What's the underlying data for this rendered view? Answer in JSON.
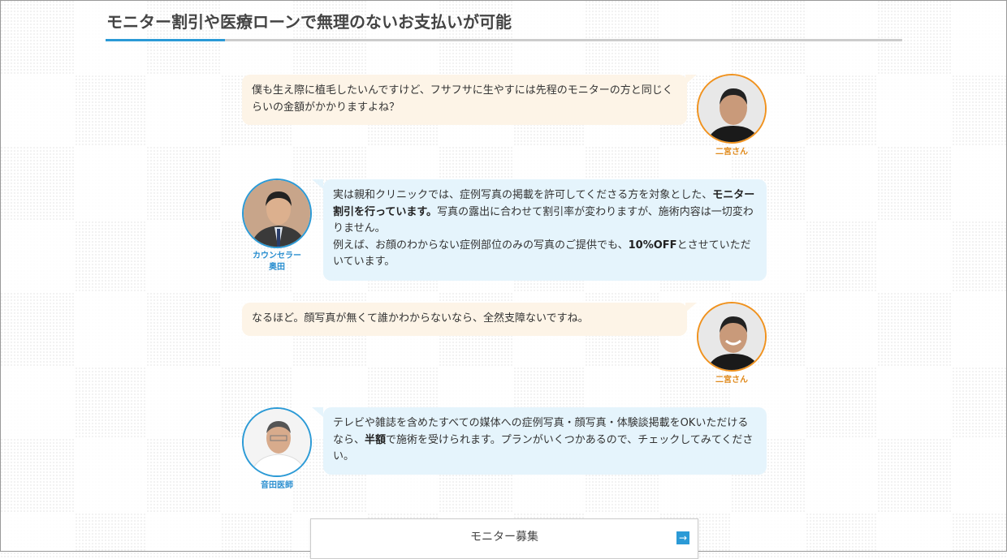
{
  "section_title": "モニター割引や医療ローンで無理のないお支払いが可能",
  "colors": {
    "accent": "#2b9ad6",
    "user": "#f0921e"
  },
  "messages": [
    {
      "speaker": "二宮さん",
      "segments": [
        {
          "t": "僕も生え際に植毛したいんですけど、フサフサに生やすには先程のモニターの方と同じくらいの金額がかかりますよね？"
        }
      ]
    },
    {
      "speaker_line1": "カウンセラー",
      "speaker_line2": "奥田",
      "segments": [
        {
          "t": "実は親和クリニックでは、症例写真の掲載を許可してくださる方を対象とした、"
        },
        {
          "t": "モニター割引を行っています。",
          "bold": true
        },
        {
          "t": "写真の露出に合わせて割引率が変わりますが、施術内容は一切変わりません。"
        },
        {
          "t": "例えば、お顔のわからない症例部位のみの写真のご提供でも、"
        },
        {
          "t": "10%OFF",
          "bold": true
        },
        {
          "t": "とさせていただいています。"
        }
      ]
    },
    {
      "speaker": "二宮さん",
      "segments": [
        {
          "t": "なるほど。顔写真が無くて誰かわからないなら、全然支障ないですね。"
        }
      ]
    },
    {
      "speaker": "音田医師",
      "segments": [
        {
          "t": "テレビや雑誌を含めたすべての媒体への症例写真・顔写真・体験談掲載をOKいただけるなら、"
        },
        {
          "t": "半額",
          "bold": true
        },
        {
          "t": "で施術を受けられます。プランがいくつかあるので、チェックしてみてください。"
        }
      ]
    }
  ],
  "cta_button": {
    "label": "モニター募集",
    "icon": "arrow-right-icon"
  }
}
